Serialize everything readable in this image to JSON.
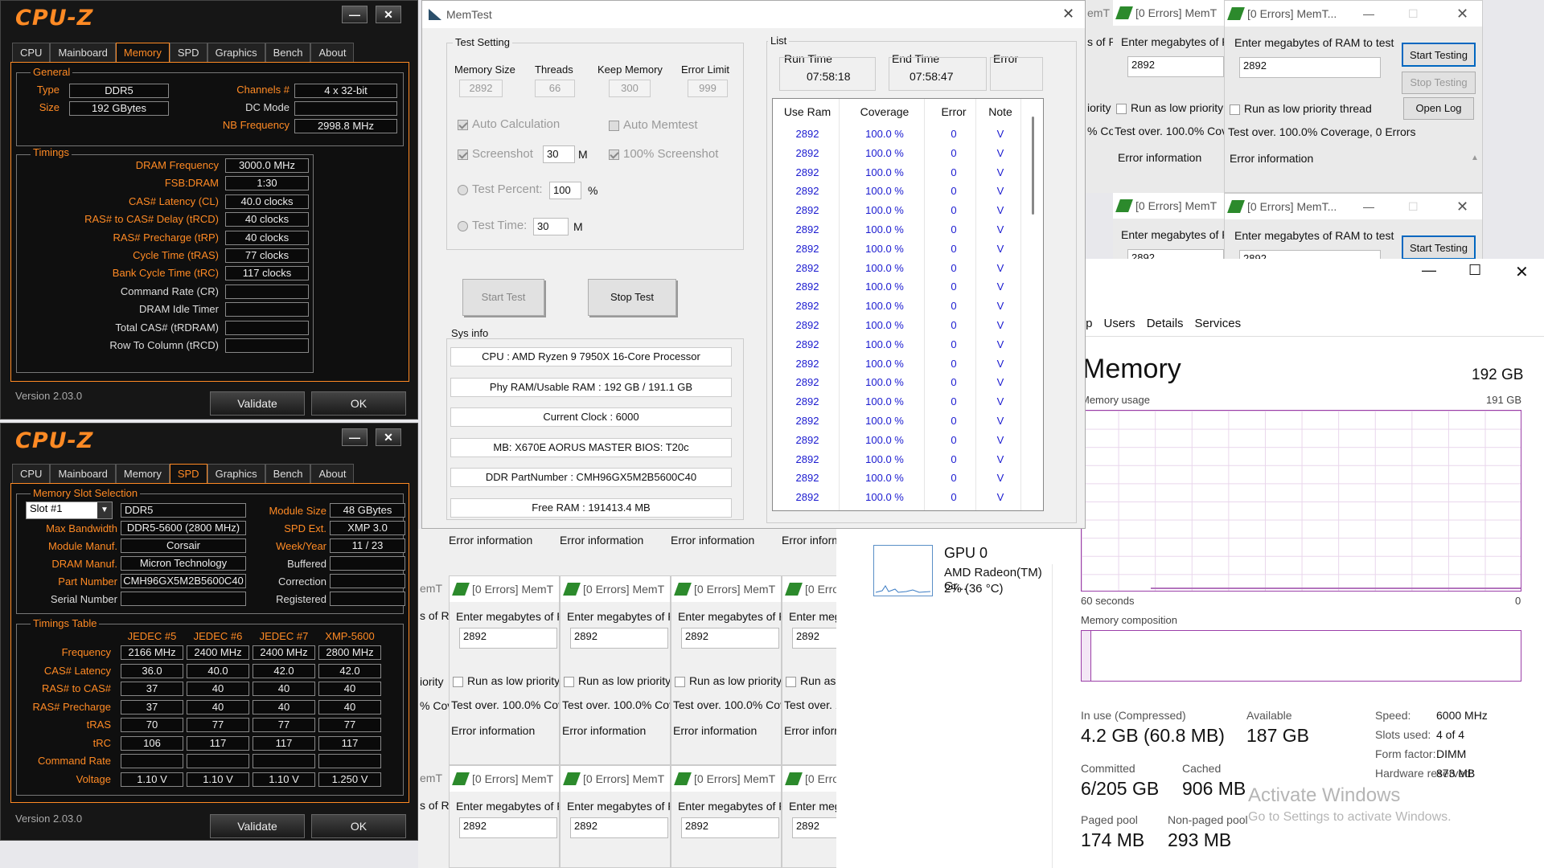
{
  "cpuz1": {
    "title": "CPU-Z",
    "tabs": [
      "CPU",
      "Mainboard",
      "Memory",
      "SPD",
      "Graphics",
      "Bench",
      "About"
    ],
    "selected_tab": "Memory",
    "general_label": "General",
    "type_label": "Type",
    "type_value": "DDR5",
    "size_label": "Size",
    "size_value": "192 GBytes",
    "channels_label": "Channels #",
    "channels_value": "4 x 32-bit",
    "dcmode_label": "DC Mode",
    "dcmode_value": "",
    "nbfreq_label": "NB Frequency",
    "nbfreq_value": "2998.8 MHz",
    "timings_label": "Timings",
    "timings": [
      {
        "label": "DRAM Frequency",
        "value": "3000.0 MHz",
        "color": "orange"
      },
      {
        "label": "FSB:DRAM",
        "value": "1:30",
        "color": "orange"
      },
      {
        "label": "CAS# Latency (CL)",
        "value": "40.0 clocks",
        "color": "orange"
      },
      {
        "label": "RAS# to CAS# Delay (tRCD)",
        "value": "40 clocks",
        "color": "orange"
      },
      {
        "label": "RAS# Precharge (tRP)",
        "value": "40 clocks",
        "color": "orange"
      },
      {
        "label": "Cycle Time (tRAS)",
        "value": "77 clocks",
        "color": "orange"
      },
      {
        "label": "Bank Cycle Time (tRC)",
        "value": "117 clocks",
        "color": "orange"
      },
      {
        "label": "Command Rate (CR)",
        "value": "",
        "color": "white"
      },
      {
        "label": "DRAM Idle Timer",
        "value": "",
        "color": "white"
      },
      {
        "label": "Total CAS# (tRDRAM)",
        "value": "",
        "color": "white"
      },
      {
        "label": "Row To Column (tRCD)",
        "value": "",
        "color": "white"
      }
    ],
    "version": "Version 2.03.0",
    "validate": "Validate",
    "ok": "OK"
  },
  "cpuz2": {
    "title": "CPU-Z",
    "tabs": [
      "CPU",
      "Mainboard",
      "Memory",
      "SPD",
      "Graphics",
      "Bench",
      "About"
    ],
    "selected_tab": "SPD",
    "slot_section": "Memory Slot Selection",
    "slot_value": "Slot #1",
    "type_value": "DDR5",
    "module_size_label": "Module Size",
    "module_size_value": "48 GBytes",
    "max_bw_label": "Max Bandwidth",
    "max_bw_value": "DDR5-5600 (2800 MHz)",
    "spd_ext_label": "SPD Ext.",
    "spd_ext_value": "XMP 3.0",
    "module_manuf_label": "Module Manuf.",
    "module_manuf_value": "Corsair",
    "week_label": "Week/Year",
    "week_value": "11 / 23",
    "dram_manuf_label": "DRAM Manuf.",
    "dram_manuf_value": "Micron Technology",
    "buffered_label": "Buffered",
    "buffered_value": "",
    "part_label": "Part Number",
    "part_value": "CMH96GX5M2B5600C40",
    "correction_label": "Correction",
    "correction_value": "",
    "serial_label": "Serial Number",
    "serial_value": "",
    "registered_label": "Registered",
    "registered_value": "",
    "timings_table_label": "Timings Table",
    "columns": [
      "JEDEC #5",
      "JEDEC #6",
      "JEDEC #7",
      "XMP-5600"
    ],
    "rows": [
      {
        "label": "Frequency",
        "values": [
          "2166 MHz",
          "2400 MHz",
          "2400 MHz",
          "2800 MHz"
        ]
      },
      {
        "label": "CAS# Latency",
        "values": [
          "36.0",
          "40.0",
          "42.0",
          "42.0"
        ]
      },
      {
        "label": "RAS# to CAS#",
        "values": [
          "37",
          "40",
          "40",
          "40"
        ]
      },
      {
        "label": "RAS# Precharge",
        "values": [
          "37",
          "40",
          "40",
          "40"
        ]
      },
      {
        "label": "tRAS",
        "values": [
          "70",
          "77",
          "77",
          "77"
        ]
      },
      {
        "label": "tRC",
        "values": [
          "106",
          "117",
          "117",
          "117"
        ]
      },
      {
        "label": "Command Rate",
        "values": [
          "",
          "",
          "",
          ""
        ]
      },
      {
        "label": "Voltage",
        "values": [
          "1.10 V",
          "1.10 V",
          "1.10 V",
          "1.250 V"
        ]
      }
    ],
    "version": "Version 2.03.0",
    "validate": "Validate",
    "ok": "OK"
  },
  "memtest": {
    "title": "MemTest",
    "test_setting": "Test Setting",
    "mem_size_label": "Memory Size",
    "mem_size_value": "2892",
    "threads_label": "Threads",
    "threads_value": "66",
    "keep_mem_label": "Keep Memory",
    "keep_mem_value": "300",
    "error_limit_label": "Error Limit",
    "error_limit_value": "999",
    "auto_calc": "Auto Calculation",
    "auto_memtest": "Auto Memtest",
    "screenshot_label": "Screenshot",
    "screenshot_value": "30",
    "screenshot_unit": "M",
    "screenshot100": "100% Screenshot",
    "test_percent_label": "Test Percent:",
    "test_percent_value": "100",
    "test_percent_unit": "%",
    "test_time_label": "Test Time:",
    "test_time_value": "30",
    "test_time_unit": "M",
    "start_test": "Start Test",
    "stop_test": "Stop Test",
    "sysinfo_label": "Sys info",
    "sysinfo": [
      "CPU : AMD Ryzen 9 7950X 16-Core Processor",
      "Phy RAM/Usable RAM : 192 GB / 191.1 GB",
      "Current Clock : 6000",
      "MB: X670E AORUS MASTER   BIOS: T20c",
      "DDR PartNumber : CMH96GX5M2B5600C40",
      "Free RAM : 191413.4 MB"
    ],
    "list_label": "List",
    "run_time_label": "Run Time",
    "run_time_value": "07:58:18",
    "end_time_label": "End Time",
    "end_time_value": "07:58:47",
    "error_label": "Error",
    "error_value": "",
    "list_headers": [
      "Use Ram",
      "Coverage",
      "Error",
      "Note"
    ],
    "list_rows": [
      [
        "2892",
        "100.0 %",
        "0",
        "V"
      ],
      [
        "2892",
        "100.0 %",
        "0",
        "V"
      ],
      [
        "2892",
        "100.0 %",
        "0",
        "V"
      ],
      [
        "2892",
        "100.0 %",
        "0",
        "V"
      ],
      [
        "2892",
        "100.0 %",
        "0",
        "V"
      ],
      [
        "2892",
        "100.0 %",
        "0",
        "V"
      ],
      [
        "2892",
        "100.0 %",
        "0",
        "V"
      ],
      [
        "2892",
        "100.0 %",
        "0",
        "V"
      ],
      [
        "2892",
        "100.0 %",
        "0",
        "V"
      ],
      [
        "2892",
        "100.0 %",
        "0",
        "V"
      ],
      [
        "2892",
        "100.0 %",
        "0",
        "V"
      ],
      [
        "2892",
        "100.0 %",
        "0",
        "V"
      ],
      [
        "2892",
        "100.0 %",
        "0",
        "V"
      ],
      [
        "2892",
        "100.0 %",
        "0",
        "V"
      ],
      [
        "2892",
        "100.0 %",
        "0",
        "V"
      ],
      [
        "2892",
        "100.0 %",
        "0",
        "V"
      ],
      [
        "2892",
        "100.0 %",
        "0",
        "V"
      ],
      [
        "2892",
        "100.0 %",
        "0",
        "V"
      ],
      [
        "2892",
        "100.0 %",
        "0",
        "V"
      ],
      [
        "2892",
        "100.0 %",
        "0",
        "V"
      ]
    ]
  },
  "small": {
    "title_short": "[0 Errors] MemT",
    "title_long": "[0 Errors] MemT...",
    "enter_short": "Enter megabytes of R",
    "enter_long": "Enter megabytes of RAM to test",
    "value": "2892",
    "low_short": "Run as low priority",
    "low_long": "Run as low priority thread",
    "over_short": "Test over. 100.0% Cov",
    "over_long": "Test over. 100.0% Coverage, 0 Errors",
    "error_info": "Error information",
    "start_testing": "Start Testing",
    "stop_testing": "Stop Testing",
    "open_log": "Open Log",
    "frag_memt": "emT",
    "frag_sof": "s of R",
    "frag_orio": "iority",
    "frag_cov": "% Cov",
    "frag_errtr": "Error informa",
    "frag_entermega": "Enter mega",
    "frag_runlo": "Run as lo",
    "frag_test10": "Test over. 1(",
    "frag_err0": "[0 Errors",
    "frag_mt": "MemT"
  },
  "taskmgr": {
    "tabs": [
      "ıp",
      "Users",
      "Details",
      "Services"
    ],
    "memory_title": "Memory",
    "memory_total": "192 GB",
    "usage_label": "Memory usage",
    "usage_max": "191 GB",
    "sixty": "60 seconds",
    "zero": "0",
    "composition": "Memory composition",
    "gpu_title": "GPU 0",
    "gpu_name": "AMD Radeon(TM) Gr...",
    "gpu_usage": "2% (36 °C)",
    "in_use_label": "In use (Compressed)",
    "in_use_value": "4.2 GB (60.8 MB)",
    "available_label": "Available",
    "available_value": "187 GB",
    "committed_label": "Committed",
    "committed_value": "6/205 GB",
    "cached_label": "Cached",
    "cached_value": "906 MB",
    "paged_label": "Paged pool",
    "paged_value": "174 MB",
    "nonpaged_label": "Non-paged pool",
    "nonpaged_value": "293 MB",
    "speed_label": "Speed:",
    "speed_value": "6000 MHz",
    "slots_label": "Slots used:",
    "slots_value": "4 of 4",
    "form_label": "Form factor:",
    "form_value": "DIMM",
    "hwres_label": "Hardware reserved:",
    "hwres_value": "873 MB",
    "activate1": "Activate Windows",
    "activate2": "Go to Settings to activate Windows."
  }
}
